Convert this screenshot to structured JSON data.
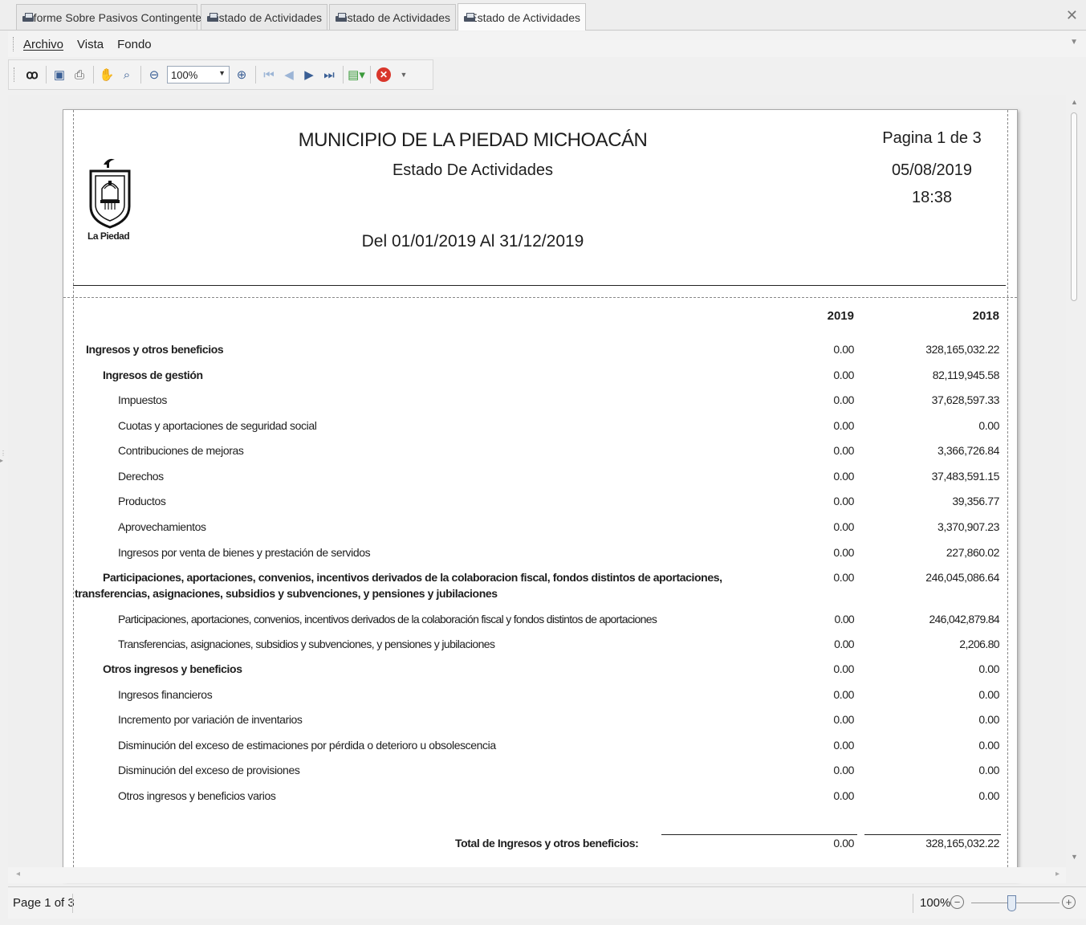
{
  "tabs": [
    {
      "label": "Informe Sobre Pasivos Contingentes",
      "active": false
    },
    {
      "label": "Estado de Actividades",
      "active": false
    },
    {
      "label": "Estado de Actividades",
      "active": false
    },
    {
      "label": "Estado de Actividades",
      "active": true
    }
  ],
  "menu": {
    "archivo": "Archivo",
    "vista": "Vista",
    "fondo": "Fondo"
  },
  "toolbar": {
    "zoom": "100%"
  },
  "report": {
    "title": "MUNICIPIO DE LA PIEDAD MICHOACÁN",
    "subtitle": "Estado De Actividades",
    "period": "Del 01/01/2019 Al 31/12/2019",
    "page_info": "Pagina 1 de 3",
    "date": "05/08/2019",
    "time": "18:38",
    "logo_text": "La Piedad",
    "col_2019": "2019",
    "col_2018": "2018",
    "rows": [
      {
        "label": "Ingresos y otros beneficios",
        "v2019": "0.00",
        "v2018": "328,165,032.22"
      },
      {
        "label": "Ingresos de gestión",
        "v2019": "0.00",
        "v2018": "82,119,945.58"
      },
      {
        "label": "Impuestos",
        "v2019": "0.00",
        "v2018": "37,628,597.33"
      },
      {
        "label": "Cuotas y aportaciones de seguridad social",
        "v2019": "0.00",
        "v2018": "0.00"
      },
      {
        "label": "Contribuciones de mejoras",
        "v2019": "0.00",
        "v2018": "3,366,726.84"
      },
      {
        "label": "Derechos",
        "v2019": "0.00",
        "v2018": "37,483,591.15"
      },
      {
        "label": "Productos",
        "v2019": "0.00",
        "v2018": "39,356.77"
      },
      {
        "label": "Aprovechamientos",
        "v2019": "0.00",
        "v2018": "3,370,907.23"
      },
      {
        "label": "Ingresos por venta de bienes y prestación de servidos",
        "v2019": "0.00",
        "v2018": "227,860.02"
      },
      {
        "label1": "Participaciones, aportaciones, convenios, incentivos derivados de la colaboracion fiscal, fondos distintos de aportaciones,",
        "label2": "transferencias, asignaciones, subsidios y subvenciones, y pensiones y jubilaciones",
        "v2019": "0.00",
        "v2018": "246,045,086.64"
      },
      {
        "label": "Participaciones, aportaciones, convenios, incentivos derivados de la colaboración fiscal y fondos distintos de aportaciones",
        "v2019": "0.00",
        "v2018": "246,042,879.84"
      },
      {
        "label": "Transferencias, asignaciones, subsidios y subvenciones, y pensiones y jubilaciones",
        "v2019": "0.00",
        "v2018": "2,206.80"
      },
      {
        "label": "Otros ingresos y beneficios",
        "v2019": "0.00",
        "v2018": "0.00"
      },
      {
        "label": "Ingresos financieros",
        "v2019": "0.00",
        "v2018": "0.00"
      },
      {
        "label": "Incremento por variación de inventarios",
        "v2019": "0.00",
        "v2018": "0.00"
      },
      {
        "label": "Disminución del exceso de estimaciones por pérdida o deterioro u obsolescencia",
        "v2019": "0.00",
        "v2018": "0.00"
      },
      {
        "label": "Disminución del exceso de provisiones",
        "v2019": "0.00",
        "v2018": "0.00"
      },
      {
        "label": "Otros ingresos y beneficios varios",
        "v2019": "0.00",
        "v2018": "0.00"
      }
    ],
    "total": {
      "label": "Total de Ingresos y otros beneficios:",
      "v2019": "0.00",
      "v2018": "328,165,032.22"
    }
  },
  "status": {
    "page": "Page 1 of 3",
    "zoom": "100%"
  }
}
